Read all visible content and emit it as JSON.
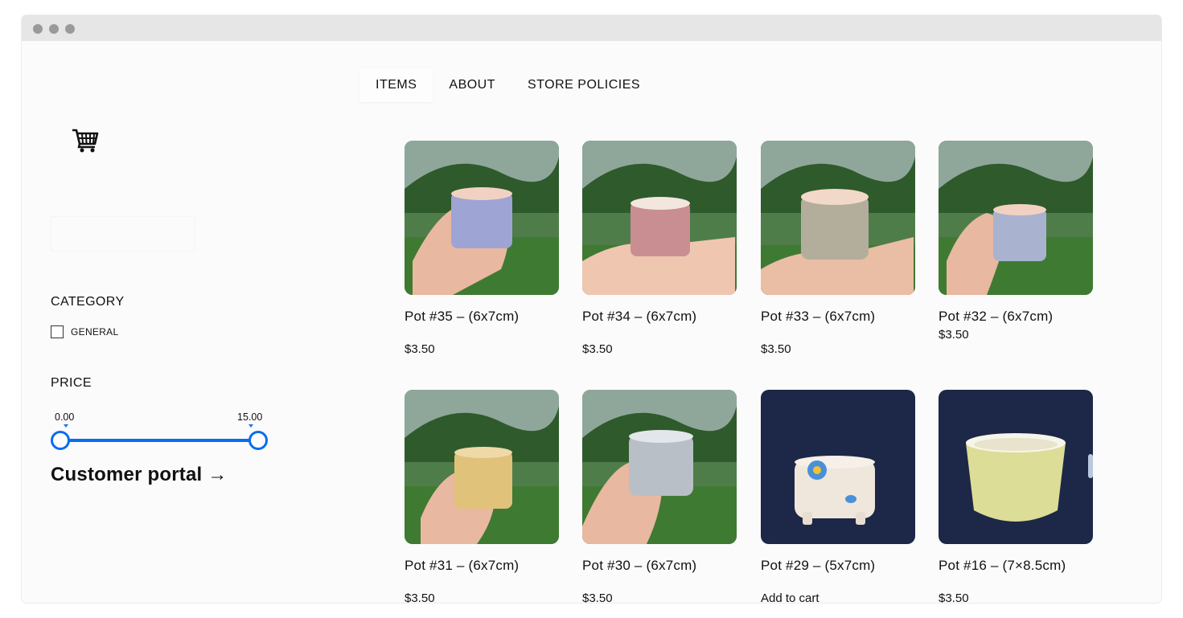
{
  "nav": {
    "items": [
      "ITEMS",
      "ABOUT",
      "STORE POLICIES"
    ]
  },
  "cart": {
    "icon": "shopping-cart-icon"
  },
  "filters": {
    "category_title": "CATEGORY",
    "categories": [
      "GENERAL"
    ],
    "price_title": "PRICE",
    "price_min": "0.00",
    "price_max": "15.00"
  },
  "portal": {
    "label": "Customer portal",
    "arrow": "→"
  },
  "products": [
    {
      "title": "Pot #35 – (6x7cm)",
      "price": "$3.50"
    },
    {
      "title": "Pot #34 – (6x7cm)",
      "price": "$3.50"
    },
    {
      "title": "Pot #33 – (6x7cm)",
      "price": "$3.50"
    },
    {
      "title": "Pot #32 – (6x7cm)",
      "price": "$3.50"
    },
    {
      "title": "Pot #31 – (6x7cm)",
      "price": "$3.50"
    },
    {
      "title": "Pot #30 – (6x7cm)",
      "price": "$3.50"
    },
    {
      "title": "Pot #29 – (5x7cm)",
      "cta": "Add to cart"
    },
    {
      "title": "Pot #16 – (7×8.5cm)",
      "price": "$3.50"
    }
  ],
  "colors": {
    "accent": "#0a6cf0",
    "titlebar": "#e6e6e6",
    "page": "#fbfbfb"
  }
}
